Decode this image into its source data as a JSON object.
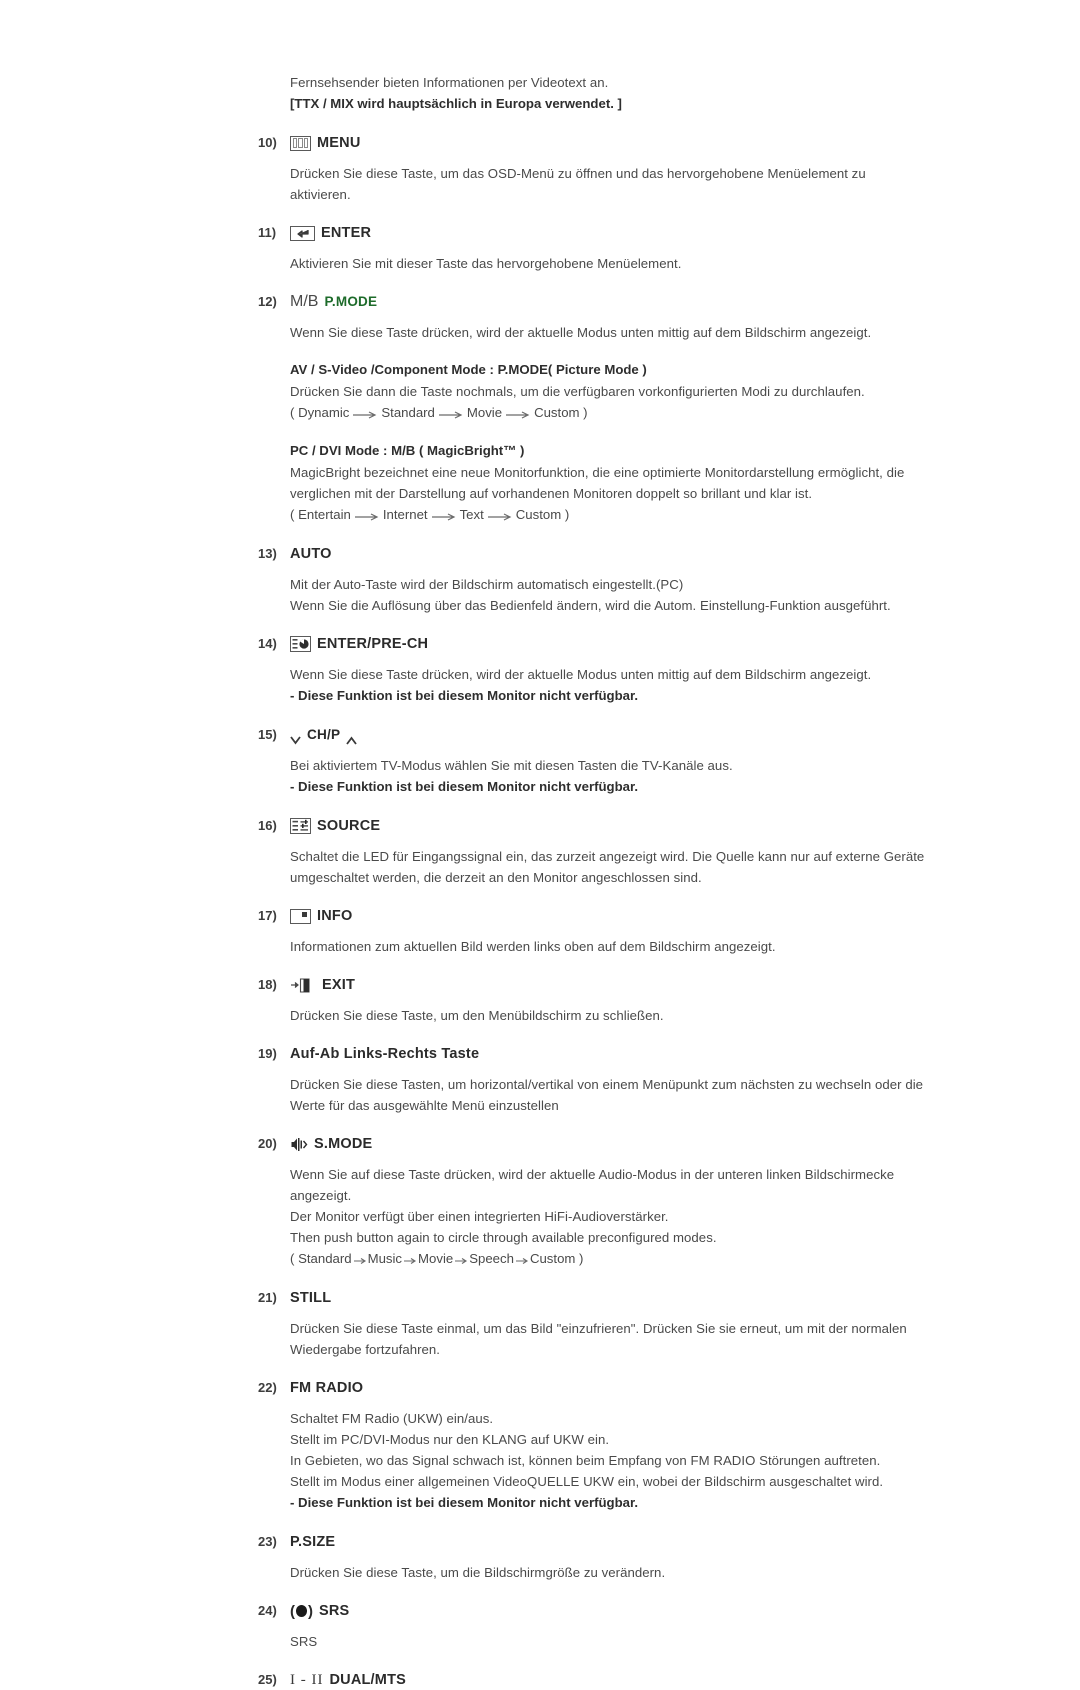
{
  "document": {
    "intro_line": "Fernsehsender bieten Informationen per Videotext an.",
    "intro_note": "[TTX / MIX wird hauptsächlich in Europa verwendet. ]"
  },
  "items": [
    {
      "num": "10)",
      "icon": "menu-icon",
      "label": "MENU",
      "paras": [
        "Drücken Sie diese Taste, um das OSD-Menü zu öffnen und das hervorgehobene Menüelement zu",
        "aktivieren."
      ]
    },
    {
      "num": "11)",
      "icon": "enter-icon",
      "label": "ENTER",
      "paras": [
        "Aktivieren Sie mit dieser Taste das hervorgehobene Menüelement."
      ]
    },
    {
      "num": "12)",
      "prefix": "M/B",
      "label": "P.MODE",
      "paras": [
        "Wenn Sie diese Taste drücken, wird der aktuelle Modus unten mittig auf dem Bildschirm angezeigt."
      ],
      "sub_a": {
        "head": "AV / S-Video /Component Mode : P.MODE( Picture Mode )",
        "para": "Drücken Sie dann die Taste nochmals, um die verfügbaren vorkonfigurierten Modi zu durchlaufen.",
        "seq_open": "( ",
        "seq_items": [
          "Dynamic",
          "Standard",
          "Movie",
          "Custom"
        ],
        "seq_close": " )"
      },
      "sub_b": {
        "head": "PC / DVI Mode : M/B ( MagicBright™ )",
        "para_1": "MagicBright bezeichnet eine neue Monitorfunktion, die eine optimierte Monitordarstellung ermöglicht, die",
        "para_2": "verglichen mit der Darstellung auf vorhandenen Monitoren doppelt so brillant und klar ist.",
        "seq_open": "( ",
        "seq_items": [
          "Entertain",
          "Internet",
          "Text",
          "Custom"
        ],
        "seq_close": " )"
      }
    },
    {
      "num": "13)",
      "label": "AUTO",
      "paras": [
        "Mit der Auto-Taste wird der Bildschirm automatisch eingestellt.(PC)",
        "Wenn Sie die Auflösung über das Bedienfeld ändern, wird die Autom. Einstellung-Funktion ausgeführt."
      ]
    },
    {
      "num": "14)",
      "icon": "enter-prech-icon",
      "label": "ENTER/PRE-CH",
      "paras": [
        "Wenn Sie diese Taste drücken, wird der aktuelle Modus unten mittig auf dem Bildschirm angezeigt."
      ],
      "note": "- Diese Funktion ist bei diesem Monitor nicht verfügbar."
    },
    {
      "num": "15)",
      "icon": "chevron-down-icon",
      "label": "CH/P",
      "icon_right": "chevron-up-icon",
      "paras": [
        "Bei aktiviertem TV-Modus wählen Sie mit diesen Tasten die TV-Kanäle aus."
      ],
      "note": "- Diese Funktion ist bei diesem Monitor nicht verfügbar."
    },
    {
      "num": "16)",
      "icon": "source-icon",
      "label": "SOURCE",
      "paras": [
        "Schaltet die LED für Eingangssignal ein, das zurzeit angezeigt wird. Die Quelle kann nur auf externe Geräte",
        "umgeschaltet werden, die derzeit an den Monitor angeschlossen sind."
      ]
    },
    {
      "num": "17)",
      "icon": "info-icon",
      "label": "INFO",
      "paras": [
        "Informationen zum aktuellen Bild werden links oben auf dem Bildschirm angezeigt."
      ]
    },
    {
      "num": "18)",
      "icon": "exit-icon",
      "label": "EXIT",
      "paras": [
        "Drücken Sie diese Taste, um den Menübildschirm zu schließen."
      ]
    },
    {
      "num": "19)",
      "label": "Auf-Ab Links-Rechts Taste",
      "paras": [
        "Drücken Sie diese Tasten, um horizontal/vertikal von einem Menüpunkt zum nächsten zu wechseln oder die",
        "Werte für das ausgewählte Menü einzustellen"
      ]
    },
    {
      "num": "20)",
      "icon": "sound-mode-icon",
      "label": "S.MODE",
      "paras": [
        "Wenn Sie auf diese Taste drücken, wird der aktuelle Audio-Modus in der unteren linken Bildschirmecke",
        "angezeigt.",
        "Der Monitor verfügt über einen integrierten HiFi-Audioverstärker.",
        "Then push button again to circle through available preconfigured modes."
      ],
      "seq_open": "( ",
      "seq_items": [
        "Standard",
        "Music",
        "Movie",
        "Speech",
        "Custom"
      ],
      "seq_close": " )"
    },
    {
      "num": "21)",
      "label": "STILL",
      "paras": [
        "Drücken Sie diese Taste einmal, um das Bild \"einzufrieren\". Drücken Sie sie erneut, um mit der normalen",
        "Wiedergabe fortzufahren."
      ]
    },
    {
      "num": "22)",
      "label": "FM RADIO",
      "paras": [
        "Schaltet FM Radio (UKW) ein/aus.",
        "Stellt im PC/DVI-Modus nur den KLANG auf UKW ein.",
        "In Gebieten, wo das Signal schwach ist, können beim Empfang von FM RADIO Störungen auftreten.",
        "Stellt im Modus einer allgemeinen VideoQUELLE UKW ein, wobei der Bildschirm ausgeschaltet wird."
      ],
      "note": "- Diese Funktion ist bei diesem Monitor nicht verfügbar."
    },
    {
      "num": "23)",
      "label": "P.SIZE",
      "paras": [
        "Drücken Sie diese Taste, um die Bildschirmgröße zu verändern."
      ]
    },
    {
      "num": "24)",
      "icon": "srs-icon",
      "label": "SRS",
      "paras": [
        "SRS"
      ]
    },
    {
      "num": "25)",
      "icon": "dual-mts-icon",
      "icon_text": "I - II",
      "label": "DUAL/MTS",
      "paras": []
    }
  ],
  "colors": {
    "body_text": "#4a4a4a",
    "heading_text": "#2b2b2b",
    "accent_green": "#1d6b2a"
  }
}
